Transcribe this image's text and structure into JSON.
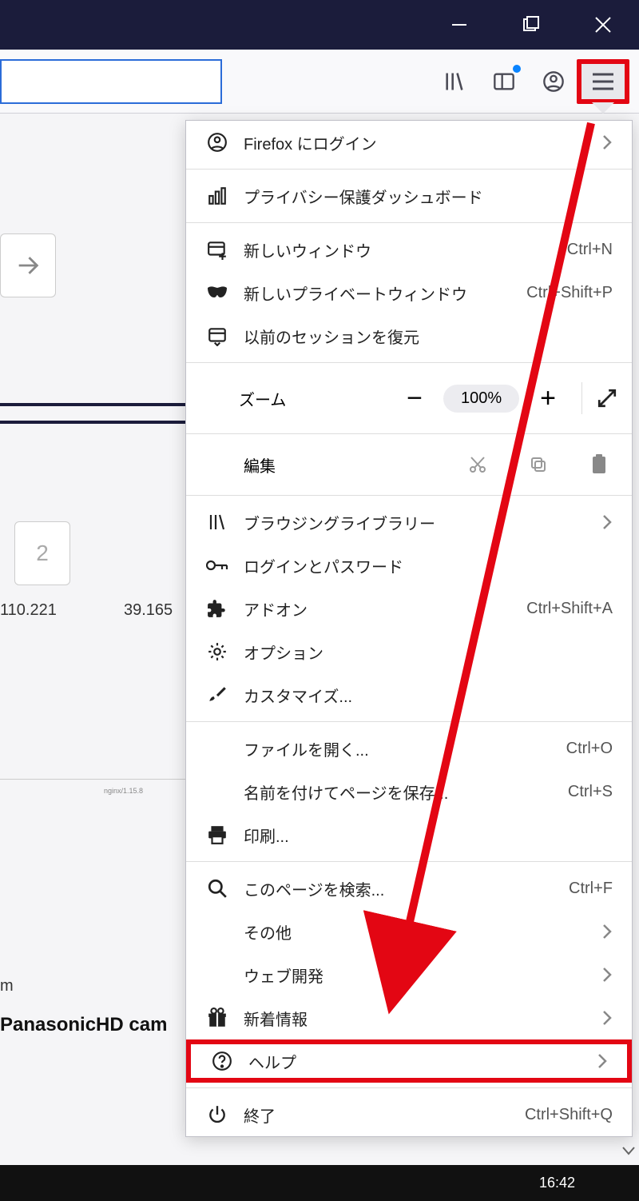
{
  "window_controls": {
    "minimize": "—",
    "maximize": "▢",
    "close": "✕"
  },
  "menu": {
    "login": {
      "label": "Firefox にログイン"
    },
    "privacy": {
      "label": "プライバシー保護ダッシュボード"
    },
    "new_window": {
      "label": "新しいウィンドウ",
      "shortcut": "Ctrl+N"
    },
    "new_private": {
      "label": "新しいプライベートウィンドウ",
      "shortcut": "Ctrl+Shift+P"
    },
    "restore_session": {
      "label": "以前のセッションを復元"
    },
    "zoom": {
      "label": "ズーム",
      "value": "100%"
    },
    "edit": {
      "label": "編集"
    },
    "library": {
      "label": "ブラウジングライブラリー"
    },
    "logins": {
      "label": "ログインとパスワード"
    },
    "addons": {
      "label": "アドオン",
      "shortcut": "Ctrl+Shift+A"
    },
    "options": {
      "label": "オプション"
    },
    "customize": {
      "label": "カスタマイズ..."
    },
    "open_file": {
      "label": "ファイルを開く...",
      "shortcut": "Ctrl+O"
    },
    "save_page": {
      "label": "名前を付けてページを保存...",
      "shortcut": "Ctrl+S"
    },
    "print": {
      "label": "印刷..."
    },
    "find": {
      "label": "このページを検索...",
      "shortcut": "Ctrl+F"
    },
    "more": {
      "label": "その他"
    },
    "webdev": {
      "label": "ウェブ開発"
    },
    "whatsnew": {
      "label": "新着情報"
    },
    "help": {
      "label": "ヘルプ"
    },
    "quit": {
      "label": "終了",
      "shortcut": "Ctrl+Shift+Q"
    }
  },
  "bg": {
    "card2": "2",
    "ip1": "110.221",
    "ip2": "39.165",
    "tiny": "nginx/1.15.8",
    "m": "m",
    "cam": "PanasonicHD cam"
  },
  "taskbar": {
    "time": "16:42"
  }
}
